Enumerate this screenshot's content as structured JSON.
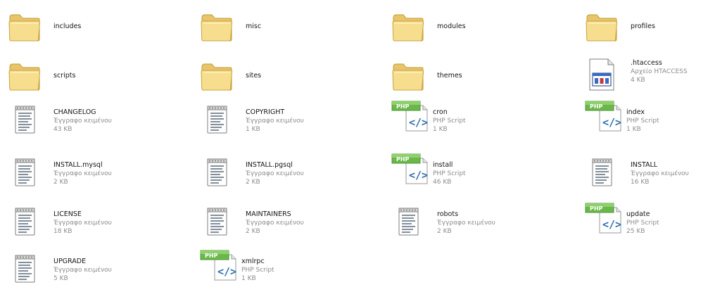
{
  "items": [
    {
      "name": "includes",
      "type": "",
      "size": "",
      "icon": "folder-icon"
    },
    {
      "name": "misc",
      "type": "",
      "size": "",
      "icon": "folder-icon"
    },
    {
      "name": "modules",
      "type": "",
      "size": "",
      "icon": "folder-icon"
    },
    {
      "name": "profiles",
      "type": "",
      "size": "",
      "icon": "folder-icon"
    },
    {
      "name": "scripts",
      "type": "",
      "size": "",
      "icon": "folder-icon"
    },
    {
      "name": "sites",
      "type": "",
      "size": "",
      "icon": "folder-icon"
    },
    {
      "name": "themes",
      "type": "",
      "size": "",
      "icon": "folder-icon"
    },
    {
      "name": ".htaccess",
      "type": "Αρχείο HTACCESS",
      "size": "4 KB",
      "icon": "htaccess-file-icon"
    },
    {
      "name": "CHANGELOG",
      "type": "Έγγραφο κειμένου",
      "size": "43 KB",
      "icon": "text-document-icon"
    },
    {
      "name": "COPYRIGHT",
      "type": "Έγγραφο κειμένου",
      "size": "1 KB",
      "icon": "text-document-icon"
    },
    {
      "name": "cron",
      "type": "PHP Script",
      "size": "1 KB",
      "icon": "php-script-icon"
    },
    {
      "name": "index",
      "type": "PHP Script",
      "size": "1 KB",
      "icon": "php-script-icon"
    },
    {
      "name": "INSTALL.mysql",
      "type": "Έγγραφο κειμένου",
      "size": "2 KB",
      "icon": "text-document-icon"
    },
    {
      "name": "INSTALL.pgsql",
      "type": "Έγγραφο κειμένου",
      "size": "2 KB",
      "icon": "text-document-icon"
    },
    {
      "name": "install",
      "type": "PHP Script",
      "size": "46 KB",
      "icon": "php-script-icon"
    },
    {
      "name": "INSTALL",
      "type": "Έγγραφο κειμένου",
      "size": "16 KB",
      "icon": "text-document-icon"
    },
    {
      "name": "LICENSE",
      "type": "Έγγραφο κειμένου",
      "size": "18 KB",
      "icon": "text-document-icon"
    },
    {
      "name": "MAINTAINERS",
      "type": "Έγγραφο κειμένου",
      "size": "2 KB",
      "icon": "text-document-icon"
    },
    {
      "name": "robots",
      "type": "Έγγραφο κειμένου",
      "size": "2 KB",
      "icon": "text-document-icon"
    },
    {
      "name": "update",
      "type": "PHP Script",
      "size": "25 KB",
      "icon": "php-script-icon"
    },
    {
      "name": "UPGRADE",
      "type": "Έγγραφο κειμένου",
      "size": "5 KB",
      "icon": "text-document-icon"
    },
    {
      "name": "xmlrpc",
      "type": "PHP Script",
      "size": "1 KB",
      "icon": "php-script-icon"
    }
  ],
  "colors": {
    "folder": "#f3d683",
    "folder_edge": "#c9a43c",
    "php_badge": "#6ab84a",
    "php_code": "#2f6fb0"
  }
}
